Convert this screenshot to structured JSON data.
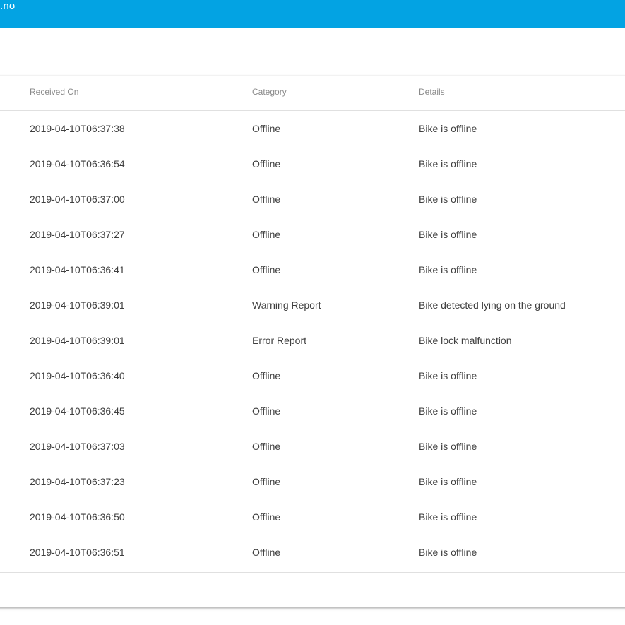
{
  "appbar": {
    "title": ".no"
  },
  "table": {
    "columns": [
      "Received On",
      "Category",
      "Details"
    ],
    "rows": [
      {
        "received_on": "2019-04-10T06:37:38",
        "category": "Offline",
        "details": "Bike is offline"
      },
      {
        "received_on": "2019-04-10T06:36:54",
        "category": "Offline",
        "details": "Bike is offline"
      },
      {
        "received_on": "2019-04-10T06:37:00",
        "category": "Offline",
        "details": "Bike is offline"
      },
      {
        "received_on": "2019-04-10T06:37:27",
        "category": "Offline",
        "details": "Bike is offline"
      },
      {
        "received_on": "2019-04-10T06:36:41",
        "category": "Offline",
        "details": "Bike is offline"
      },
      {
        "received_on": "2019-04-10T06:39:01",
        "category": "Warning Report",
        "details": "Bike detected lying on the ground"
      },
      {
        "received_on": "2019-04-10T06:39:01",
        "category": "Error Report",
        "details": "Bike lock malfunction"
      },
      {
        "received_on": "2019-04-10T06:36:40",
        "category": "Offline",
        "details": "Bike is offline"
      },
      {
        "received_on": "2019-04-10T06:36:45",
        "category": "Offline",
        "details": "Bike is offline"
      },
      {
        "received_on": "2019-04-10T06:37:03",
        "category": "Offline",
        "details": "Bike is offline"
      },
      {
        "received_on": "2019-04-10T06:37:23",
        "category": "Offline",
        "details": "Bike is offline"
      },
      {
        "received_on": "2019-04-10T06:36:50",
        "category": "Offline",
        "details": "Bike is offline"
      },
      {
        "received_on": "2019-04-10T06:36:51",
        "category": "Offline",
        "details": "Bike is offline"
      }
    ]
  },
  "colors": {
    "appbar": "#03a3e3",
    "text": "#3f3f3f",
    "header_text": "#8a8a8a"
  }
}
